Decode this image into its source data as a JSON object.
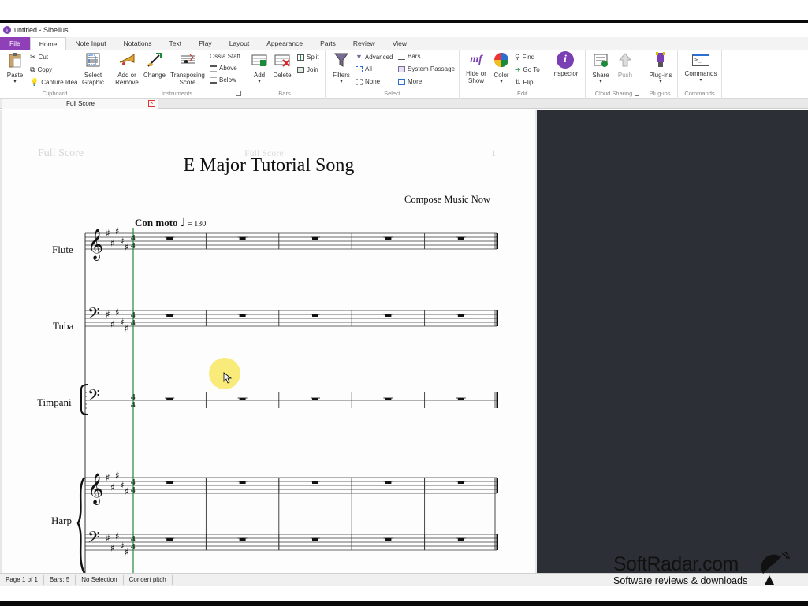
{
  "window": {
    "title": "untitled - Sibelius",
    "logo_glyph": "♭"
  },
  "ribbon_tabs": [
    {
      "label": "File"
    },
    {
      "label": "Home"
    },
    {
      "label": "Note Input"
    },
    {
      "label": "Notations"
    },
    {
      "label": "Text"
    },
    {
      "label": "Play"
    },
    {
      "label": "Layout"
    },
    {
      "label": "Appearance"
    },
    {
      "label": "Parts"
    },
    {
      "label": "Review"
    },
    {
      "label": "View"
    }
  ],
  "ribbon": {
    "clipboard": {
      "label": "Clipboard",
      "paste": "Paste",
      "cut": "Cut",
      "copy": "Copy",
      "capture": "Capture Idea",
      "select_graphic_1": "Select",
      "select_graphic_2": "Graphic"
    },
    "instruments": {
      "label": "Instruments",
      "add_remove_1": "Add or",
      "add_remove_2": "Remove",
      "change": "Change",
      "transposing_1": "Transposing",
      "transposing_2": "Score",
      "ossia": "Ossia Staff",
      "above": "Above",
      "below": "Below"
    },
    "bars": {
      "label": "Bars",
      "add": "Add",
      "delete": "Delete",
      "split": "Split",
      "join": "Join"
    },
    "select": {
      "label": "Select",
      "filters": "Filters",
      "advanced": "Advanced",
      "all": "All",
      "none": "None",
      "bars": "Bars",
      "system_passage": "System Passage",
      "more": "More"
    },
    "edit": {
      "label": "Edit",
      "hide_show_1": "Hide or",
      "hide_show_2": "Show",
      "color": "Color",
      "find": "Find",
      "goto": "Go To",
      "flip": "Flip",
      "inspector": "Inspector",
      "mf_glyph": "mf",
      "i_glyph": "i"
    },
    "cloud": {
      "label": "Cloud Sharing",
      "share": "Share",
      "push": "Push"
    },
    "plugins": {
      "label": "Plug-ins",
      "plugins": "Plug-ins"
    },
    "commands": {
      "label": "Commands",
      "commands": "Commands",
      "prompt_glyph": ">_"
    }
  },
  "document_tab": {
    "label": "Full Score",
    "close": "×"
  },
  "score": {
    "header_left": "Full Score",
    "header_center": "Full Score",
    "page_number": "1",
    "title": "E Major Tutorial Song",
    "composer": "Compose Music Now",
    "tempo_text": "Con moto",
    "tempo_note": "♩",
    "tempo_value": "= 130",
    "instruments": [
      {
        "name": "Flute",
        "clef": "𝄞"
      },
      {
        "name": "Tuba",
        "clef": "𝄢"
      },
      {
        "name": "Timpani",
        "clef": "𝄢"
      },
      {
        "name": "Harp",
        "clef": "𝄞"
      }
    ],
    "time_sig_top": "4",
    "time_sig_bottom": "4",
    "bars": 5
  },
  "status": {
    "page": "Page 1 of 1",
    "bars": "Bars: 5",
    "selection": "No Selection",
    "pitch": "Concert pitch"
  },
  "watermark": {
    "title": "SoftRadar.com",
    "subtitle": "Software reviews & downloads"
  },
  "colors": {
    "file_tab": "#8f3fb7",
    "playline": "#1e8a3a",
    "dark_panel": "#2c3036",
    "cursor_highlight": "#f7e861"
  }
}
